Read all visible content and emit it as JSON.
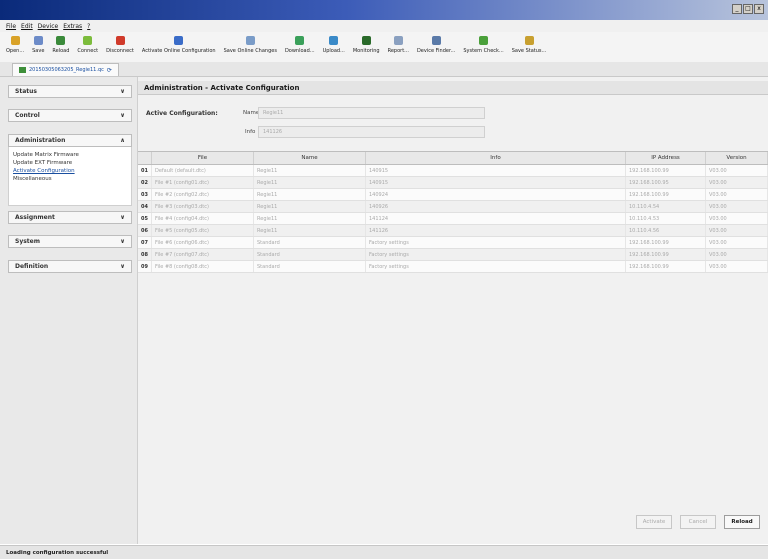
{
  "window": {
    "controls": [
      "_",
      "□",
      "x"
    ]
  },
  "menu": [
    "File",
    "Edit",
    "Device",
    "Extras",
    "?"
  ],
  "toolbar": [
    {
      "label": "Open...",
      "icon": "folder-open-icon",
      "color": "#d9a228"
    },
    {
      "label": "Save",
      "icon": "save-disk-icon",
      "color": "#6c8bc8"
    },
    {
      "label": "Reload",
      "icon": "reload-icon",
      "color": "#3a8a3a"
    },
    {
      "label": "Connect",
      "icon": "connect-plug-icon",
      "color": "#7cbc3c"
    },
    {
      "label": "Disconnect",
      "icon": "disconnect-plug-icon",
      "color": "#d03a2a"
    },
    {
      "label": "Activate Online Configuration",
      "icon": "activate-config-icon",
      "color": "#3a6cc8"
    },
    {
      "label": "Save Online Changes",
      "icon": "save-changes-icon",
      "color": "#7a9cc8"
    },
    {
      "label": "Download...",
      "icon": "download-icon",
      "color": "#3aa05a"
    },
    {
      "label": "Upload...",
      "icon": "upload-icon",
      "color": "#3a8ac8"
    },
    {
      "label": "Monitoring",
      "icon": "monitoring-icon",
      "color": "#2a6a2a"
    },
    {
      "label": "Report...",
      "icon": "report-icon",
      "color": "#8aa0c0"
    },
    {
      "label": "Device Finder...",
      "icon": "device-finder-icon",
      "color": "#5a7aa8"
    },
    {
      "label": "System Check...",
      "icon": "system-check-icon",
      "color": "#4aa03a"
    },
    {
      "label": "Save Status...",
      "icon": "save-status-icon",
      "color": "#c8a030"
    }
  ],
  "tab": {
    "label": "20150305063205_Regie11.qc"
  },
  "sidebar": {
    "sections": [
      {
        "label": "Status",
        "expanded": false
      },
      {
        "label": "Control",
        "expanded": false
      },
      {
        "label": "Administration",
        "expanded": true
      },
      {
        "label": "Assignment",
        "expanded": false
      },
      {
        "label": "System",
        "expanded": false
      },
      {
        "label": "Definition",
        "expanded": false
      }
    ],
    "admin_items": [
      "Update Matrix Firmware",
      "Update EXT Firmware",
      "Activate Configuration",
      "Miscellaneous"
    ],
    "active_item": "Activate Configuration"
  },
  "panel": {
    "title": "Administration - Activate Configuration",
    "active_label": "Active Configuration:",
    "name_label": "Name",
    "name_value": "Regie11",
    "info_label": "Info",
    "info_value": "141126"
  },
  "table": {
    "headers": [
      "File",
      "Name",
      "Info",
      "IP Address",
      "Version"
    ],
    "rows": [
      {
        "num": "01",
        "file": "Default (default.dtc)",
        "name": "Regie11",
        "info": "140915",
        "ip": "192.168.100.99",
        "version": "V03.00"
      },
      {
        "num": "02",
        "file": "File #1 (config01.dtc)",
        "name": "Regie11",
        "info": "140915",
        "ip": "192.168.100.95",
        "version": "V03.00"
      },
      {
        "num": "03",
        "file": "File #2 (config02.dtc)",
        "name": "Regie11",
        "info": "140924",
        "ip": "192.168.100.99",
        "version": "V03.00"
      },
      {
        "num": "04",
        "file": "File #3 (config03.dtc)",
        "name": "Regie11",
        "info": "140926",
        "ip": "10.110.4.54",
        "version": "V03.00"
      },
      {
        "num": "05",
        "file": "File #4 (config04.dtc)",
        "name": "Regie11",
        "info": "141124",
        "ip": "10.110.4.53",
        "version": "V03.00"
      },
      {
        "num": "06",
        "file": "File #5 (config05.dtc)",
        "name": "Regie11",
        "info": "141126",
        "ip": "10.110.4.56",
        "version": "V03.00"
      },
      {
        "num": "07",
        "file": "File #6 (config06.dtc)",
        "name": "Standard",
        "info": "Factory settings",
        "ip": "192.168.100.99",
        "version": "V03.00"
      },
      {
        "num": "08",
        "file": "File #7 (config07.dtc)",
        "name": "Standard",
        "info": "Factory settings",
        "ip": "192.168.100.99",
        "version": "V03.00"
      },
      {
        "num": "09",
        "file": "File #8 (config08.dtc)",
        "name": "Standard",
        "info": "Factory settings",
        "ip": "192.168.100.99",
        "version": "V03.00"
      }
    ]
  },
  "buttons": {
    "activate": "Activate",
    "cancel": "Cancel",
    "reload": "Reload"
  },
  "status": "Loading configuration successful"
}
